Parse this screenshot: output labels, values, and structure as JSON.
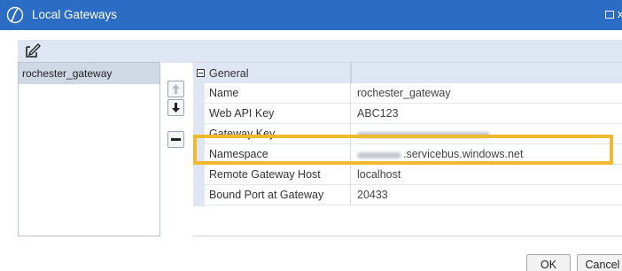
{
  "window": {
    "title": "Local Gateways",
    "close_glyph": "x"
  },
  "toolbar": {
    "edit_icon": "edit-icon"
  },
  "gateways": {
    "items": [
      {
        "label": "rochester_gateway",
        "selected": true
      }
    ]
  },
  "side_buttons": {
    "icons": [
      "move-up-icon",
      "move-down-icon",
      "remove-icon"
    ]
  },
  "properties": {
    "category": "General",
    "rows": [
      {
        "key": "Name",
        "value": "rochester_gateway"
      },
      {
        "key": "Web API Key",
        "value": "ABC123"
      },
      {
        "key": "Gateway Key",
        "value": ""
      },
      {
        "key": "Namespace",
        "value": ".servicebus.windows.net"
      },
      {
        "key": "Remote Gateway Host",
        "value": "localhost"
      },
      {
        "key": "Bound Port at Gateway",
        "value": "20433"
      }
    ]
  },
  "buttons": {
    "ok": "OK",
    "cancel": "Cancel"
  },
  "colors": {
    "titlebar": "#2b6cc4",
    "highlight": "#f0b82c",
    "category_bg": "#dde6f2",
    "selection_bg": "#cfd9e6"
  }
}
